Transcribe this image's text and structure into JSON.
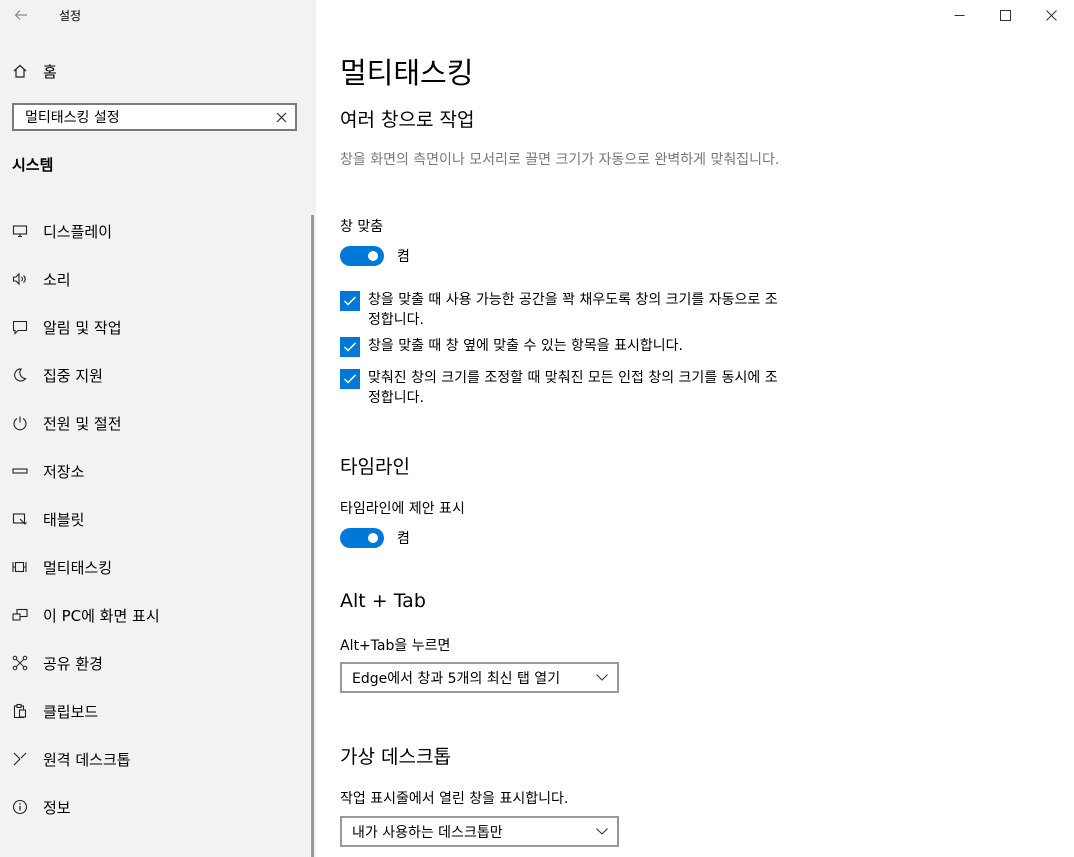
{
  "app": {
    "title": "설정",
    "back_icon": "back-arrow-icon"
  },
  "sidebar": {
    "home_label": "홈",
    "search": {
      "value": "멀티태스킹 설정"
    },
    "section_title": "시스템",
    "items": [
      {
        "label": "디스플레이",
        "icon": "monitor-icon"
      },
      {
        "label": "소리",
        "icon": "speaker-icon"
      },
      {
        "label": "알림 및 작업",
        "icon": "message-icon"
      },
      {
        "label": "집중 지원",
        "icon": "moon-icon"
      },
      {
        "label": "전원 및 절전",
        "icon": "power-icon"
      },
      {
        "label": "저장소",
        "icon": "storage-icon"
      },
      {
        "label": "태블릿",
        "icon": "tablet-icon"
      },
      {
        "label": "멀티태스킹",
        "icon": "multitask-icon"
      },
      {
        "label": "이 PC에 화면 표시",
        "icon": "project-icon"
      },
      {
        "label": "공유 환경",
        "icon": "share-icon"
      },
      {
        "label": "클립보드",
        "icon": "clipboard-icon"
      },
      {
        "label": "원격 데스크톱",
        "icon": "remote-icon"
      },
      {
        "label": "정보",
        "icon": "info-icon"
      }
    ]
  },
  "main": {
    "title": "멀티태스킹",
    "snap": {
      "heading": "여러 창으로 작업",
      "description": "창을 화면의 측면이나 모서리로 끌면 크기가 자동으로 완벽하게 맞춰집니다.",
      "toggle_label": "창 맞춤",
      "toggle_state": "켬",
      "checkboxes": [
        {
          "label": "창을 맞출 때 사용 가능한 공간을 꽉 채우도록 창의 크기를 자동으로 조정합니다.",
          "checked": true
        },
        {
          "label": "창을 맞출 때 창 옆에 맞출 수 있는 항목을 표시합니다.",
          "checked": true
        },
        {
          "label": "맞춰진 창의 크기를 조정할 때 맞춰진 모든 인접 창의 크기를 동시에 조정합니다.",
          "checked": true
        }
      ]
    },
    "timeline": {
      "heading": "타임라인",
      "toggle_label": "타임라인에 제안 표시",
      "toggle_state": "켬"
    },
    "alttab": {
      "heading": "Alt + Tab",
      "label": "Alt+Tab을 누르면",
      "selected": "Edge에서 창과 5개의 최신 탭 열기"
    },
    "vdesktop": {
      "heading": "가상 데스크톱",
      "label": "작업 표시줄에서 열린 창을 표시합니다.",
      "selected": "내가 사용하는 데스크톱만"
    }
  },
  "colors": {
    "accent": "#0078d7",
    "sidebar_bg": "#f2f2f2",
    "muted_text": "#777777"
  }
}
